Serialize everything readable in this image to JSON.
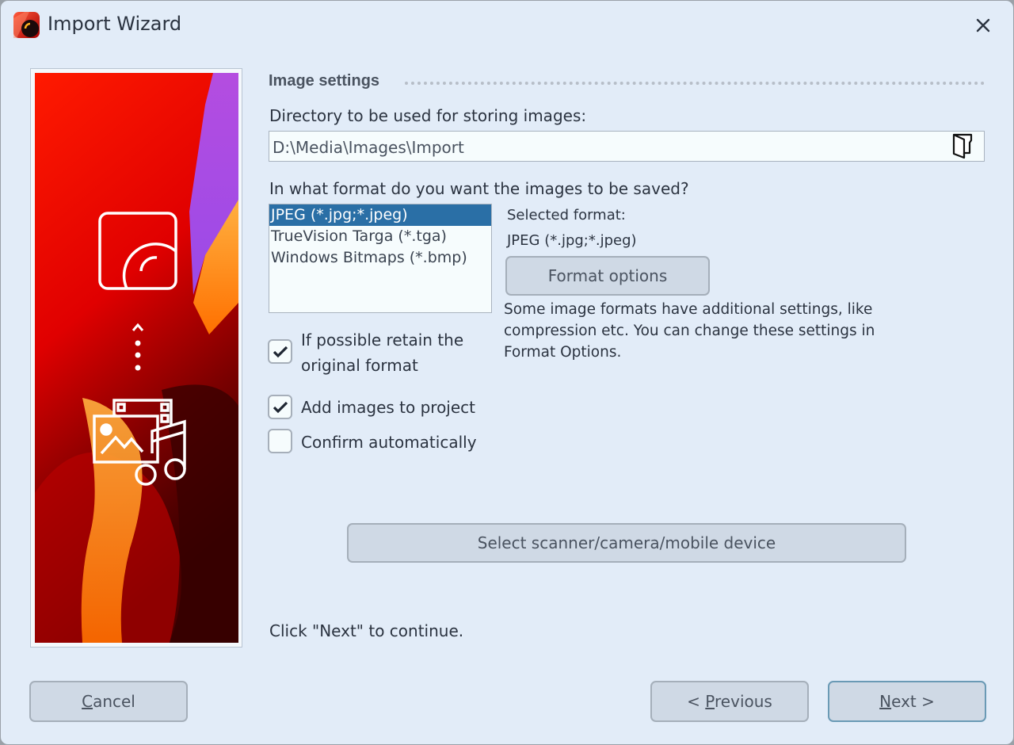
{
  "window": {
    "title": "Import Wizard",
    "close_icon": "close-icon",
    "app_icon": "app-logo-icon"
  },
  "sidebar": {
    "icons": [
      "photo-app-icon",
      "chevron-up-icon",
      "dots-icon",
      "media-files-icon"
    ]
  },
  "section": {
    "title": "Image settings"
  },
  "directory": {
    "label": "Directory to be used for storing images:",
    "value": "D:\\Media\\Images\\Import",
    "browse_icon": "folder-open-icon"
  },
  "format": {
    "question": "In what format do you want the images to be saved?",
    "options": [
      {
        "label": "JPEG (*.jpg;*.jpeg)",
        "selected": true
      },
      {
        "label": "TrueVision Targa (*.tga)",
        "selected": false
      },
      {
        "label": "Windows Bitmaps (*.bmp)",
        "selected": false
      }
    ],
    "selected_label": "Selected format:",
    "selected_value": "JPEG (*.jpg;*.jpeg)",
    "options_button": "Format options",
    "help_text": "Some image formats have additional settings, like compression etc. You can change these settings in Format Options."
  },
  "checkboxes": [
    {
      "label_line1": "If possible retain the",
      "label_line2": "original format",
      "checked": true
    },
    {
      "label": "Add images to project",
      "checked": true
    },
    {
      "label": "Confirm automatically",
      "checked": false
    }
  ],
  "device_button": "Select scanner/camera/mobile device",
  "continue_hint": "Click \"Next\" to continue.",
  "footer": {
    "cancel": {
      "mnemonic": "C",
      "rest": "ancel"
    },
    "previous": {
      "prefix": "< ",
      "mnemonic": "P",
      "rest": "revious"
    },
    "next": {
      "mnemonic": "N",
      "rest": "ext >"
    }
  }
}
